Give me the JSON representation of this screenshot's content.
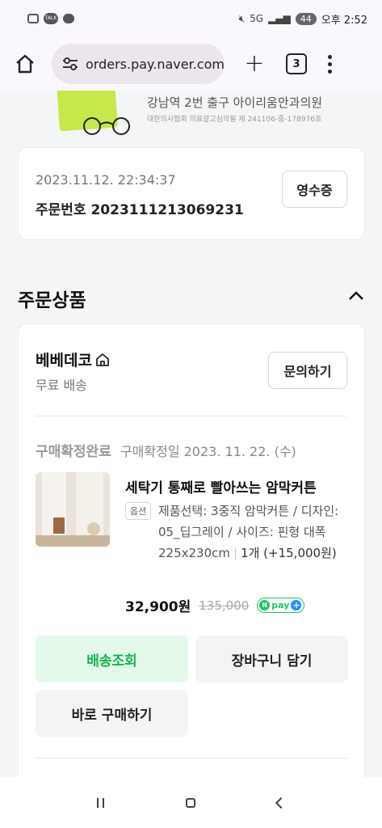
{
  "status_bar": {
    "time": "오후 2:52",
    "battery": "44",
    "network": "5G",
    "talk_label": "TALK"
  },
  "browser": {
    "url": "orders.pay.naver.com/",
    "tab_count": "3"
  },
  "ad": {
    "title": "강남역 2번 출구 아이리움안과의원",
    "subtitle": "대한의사협회 의료광고심의필 제 241106-중-178976호"
  },
  "order_info": {
    "date": "2023.11.12. 22:34:37",
    "order_number": "주문번호 2023111213069231",
    "receipt_label": "영수증"
  },
  "section": {
    "title": "주문상품"
  },
  "shop": {
    "name": "베베데코",
    "delivery": "무료 배송",
    "inquire_label": "문의하기"
  },
  "product": {
    "status": "구매확정완료",
    "status_date": "구매확정일 2023. 11. 22. (수)",
    "name": "세탁기 통째로 빨아쓰는 암막커튼",
    "option_badge": "옵션",
    "option_text": "제품선택: 3중직 암막커튼 / 디자인: 05_딥그레이 / 사이즈: 핀형 대폭 225x230cm",
    "quantity": "1개 (+15,000원)",
    "price": "32,900원",
    "original_price": "135,000",
    "npay_n": "N",
    "npay_label": "pay"
  },
  "actions": {
    "track": "배송조회",
    "cart": "장바구니 담기",
    "buy_now": "바로 구매하기"
  },
  "colors": {
    "accent_green": "#14b34e",
    "track_bg": "#e3f9ea",
    "npay_green": "#19c563",
    "npay_blue": "#1f8fff"
  }
}
